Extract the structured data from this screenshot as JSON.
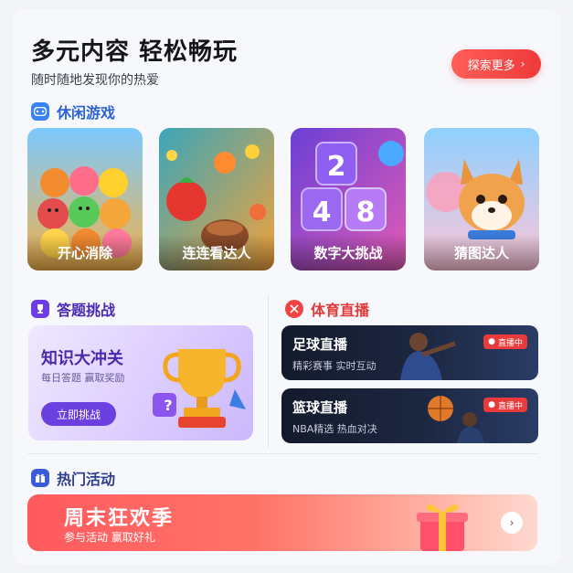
{
  "header": {
    "title": "多元内容 轻松畅玩",
    "subtitle": "随时随地发现你的热爱",
    "explore_label": "探索更多",
    "explore_chevron": "›"
  },
  "sections": {
    "casual_games": {
      "title": "休闲游戏",
      "icon": "gamepad-icon",
      "color": "#3b82f6"
    },
    "quiz": {
      "title": "答题挑战",
      "icon": "trophy-icon",
      "color": "#6d3ce6"
    },
    "sports": {
      "title": "体育直播",
      "icon": "live-icon",
      "color": "#ef4444"
    },
    "events": {
      "title": "热门活动",
      "icon": "gift-icon",
      "color": "#3b5bdb"
    }
  },
  "games": [
    {
      "label": "开心消除",
      "icon": "candy-match-icon"
    },
    {
      "label": "连连看达人",
      "icon": "fruit-link-icon"
    },
    {
      "label": "数字大挑战",
      "icon": "number-block-icon"
    },
    {
      "label": "猜图达人",
      "icon": "shiba-dog-icon"
    }
  ],
  "quiz_card": {
    "title": "知识大冲关",
    "subtitle": "每日答题 赢取奖励",
    "button": "立即挑战",
    "badge_text": "?"
  },
  "sports_cards": [
    {
      "title": "足球直播",
      "subtitle": "精彩赛事 实时互动",
      "live": "直播中"
    },
    {
      "title": "篮球直播",
      "subtitle": "NBA精选 热血对决",
      "live": "直播中"
    }
  ],
  "banner": {
    "title": "周末狂欢季",
    "subtitle": "参与活动 赢取好礼",
    "arrow": "›"
  },
  "digits": [
    "2",
    "4",
    "8"
  ]
}
